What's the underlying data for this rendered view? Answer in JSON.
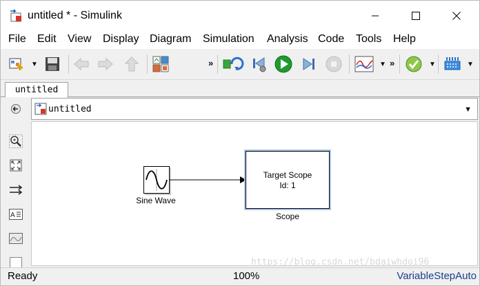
{
  "window": {
    "title": "untitled * - Simulink",
    "icon": "simulink-model-icon",
    "controls": [
      "minimize-icon",
      "maximize-icon",
      "close-icon"
    ]
  },
  "menu": {
    "items": [
      {
        "label": "File"
      },
      {
        "label": "Edit"
      },
      {
        "label": "View"
      },
      {
        "label": "Display"
      },
      {
        "label": "Diagram"
      },
      {
        "label": "Simulation"
      },
      {
        "label": "Analysis"
      },
      {
        "label": "Code"
      },
      {
        "label": "Tools"
      },
      {
        "label": "Help"
      }
    ]
  },
  "toolbar": {
    "icons": [
      "new-model-icon",
      "save-icon",
      "back-icon",
      "forward-icon",
      "up-icon",
      "library-browser-icon",
      "model-configuration-icon",
      "step-back-icon",
      "run-icon",
      "step-forward-icon",
      "stop-icon",
      "record-icon",
      "model-advisor-icon",
      "build-icon"
    ]
  },
  "tabs": [
    {
      "label": "untitled"
    }
  ],
  "address": {
    "path": "untitled"
  },
  "palette": {
    "icons": [
      "hide-browser-icon",
      "zoom-icon",
      "fit-to-view-icon",
      "route-lines-icon",
      "annotation-icon",
      "image-icon",
      "area-icon"
    ]
  },
  "diagram": {
    "sine_block_label": "Sine Wave",
    "scope_block_line1": "Target Scope",
    "scope_block_line2": "Id: 1",
    "scope_block_label": "Scope",
    "watermark": "https://blog.csdn.net/bdaiwhdoi96"
  },
  "status": {
    "left": "Ready",
    "zoom": "100%",
    "solver": "VariableStepAuto"
  },
  "colors": {
    "run_green": "#1e9a2e",
    "selection_blue": "#a8c4e8",
    "solver_text": "#1a3c8c"
  }
}
